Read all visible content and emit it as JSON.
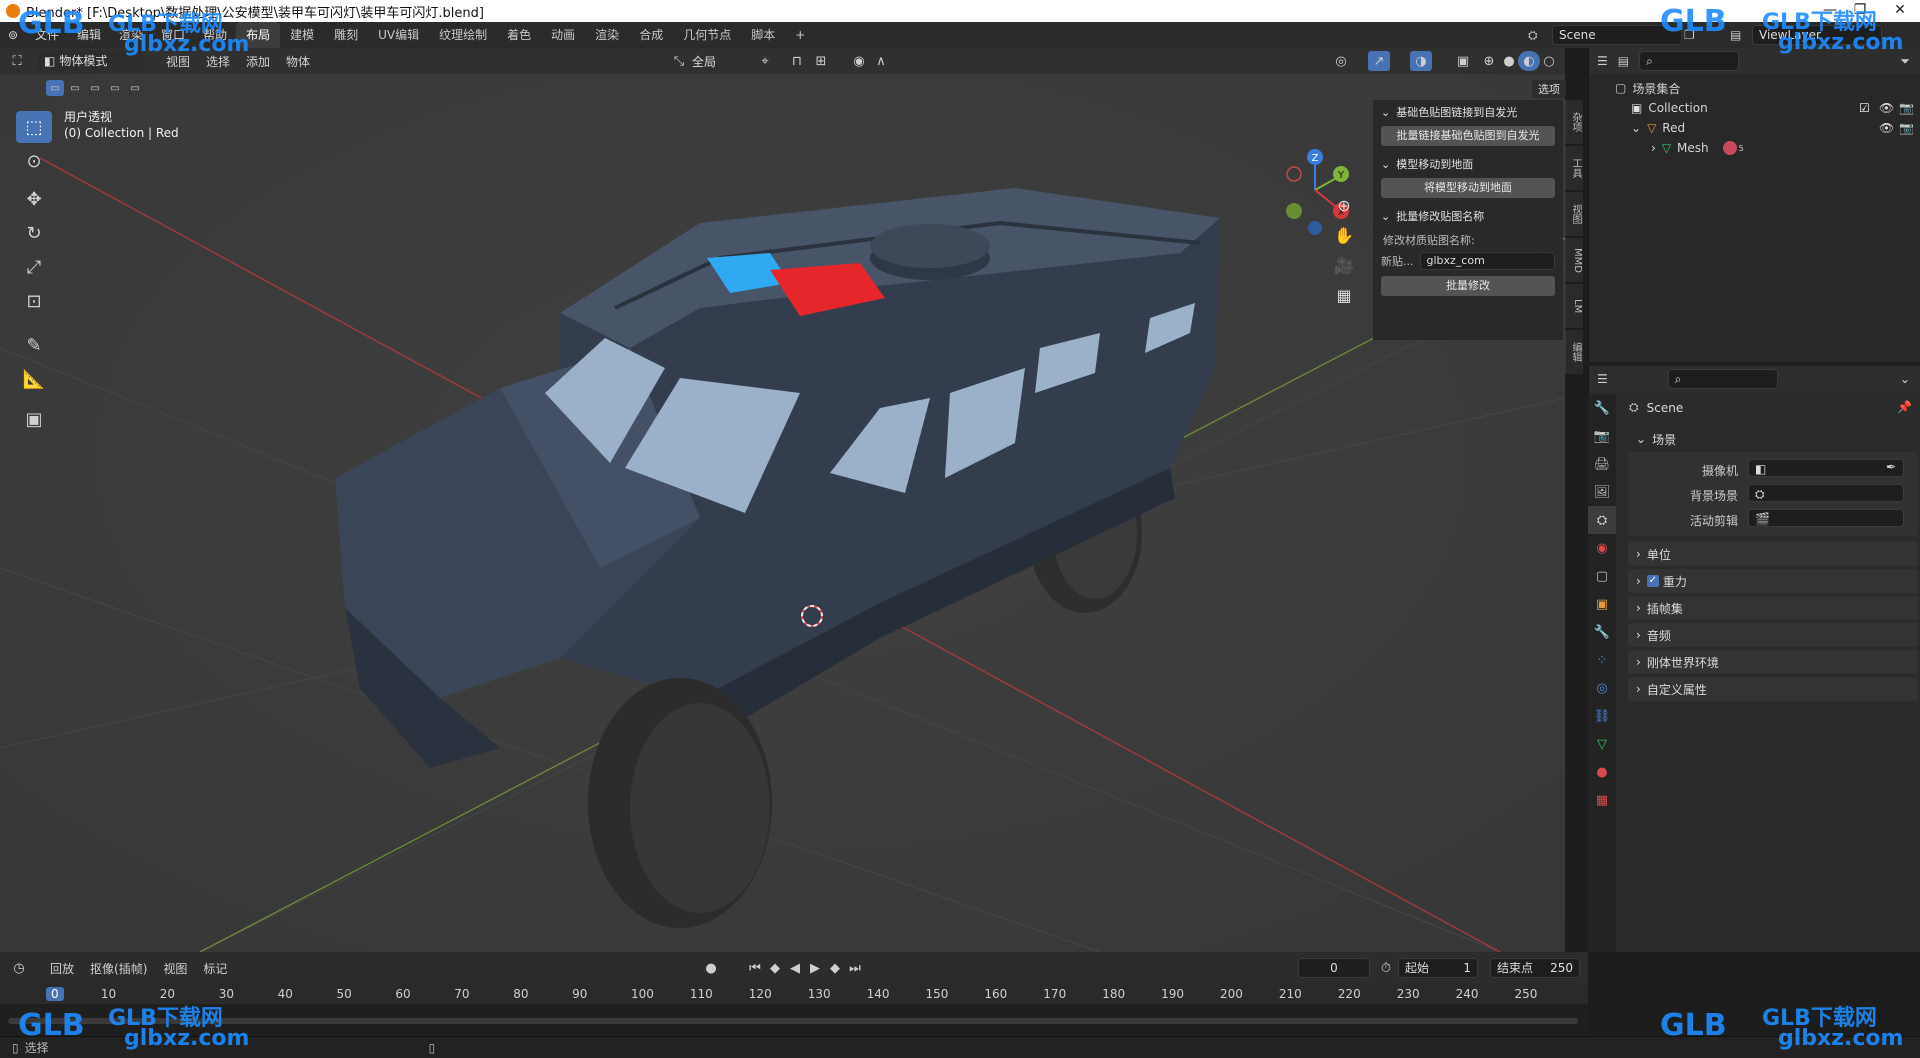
{
  "window": {
    "title": "Blender* [F:\\Desktop\\数据处理\\公安模型\\装甲车可闪灯\\装甲车可闪灯.blend]"
  },
  "topbar": {
    "menus": [
      "文件",
      "编辑",
      "渲染",
      "窗口",
      "帮助"
    ],
    "workspaces": [
      "布局",
      "建模",
      "雕刻",
      "UV编辑",
      "纹理绘制",
      "着色",
      "动画",
      "渲染",
      "合成",
      "几何节点",
      "脚本"
    ],
    "active_workspace": "布局",
    "add_tab": "+",
    "scene": "Scene",
    "view_layer": "ViewLayer"
  },
  "viewport": {
    "mode": "物体模式",
    "menus": [
      "视图",
      "选择",
      "添加",
      "物体"
    ],
    "transform_orientation": "全局",
    "options_label": "选项",
    "overlay_title": "用户透视",
    "overlay_subtitle": "(0) Collection | Red",
    "axis_labels": {
      "z": "Z",
      "y": "Y",
      "x": "X"
    }
  },
  "npanel": {
    "sections": [
      {
        "title": "基础色贴图链接到自发光",
        "button": "批量链接基础色贴图到自发光"
      },
      {
        "title": "模型移动到地面",
        "button": "将模型移动到地面"
      },
      {
        "title": "批量修改贴图名称",
        "label": "修改材质贴图名称:",
        "field_label": "新贴...",
        "field_value": "glbxz_com",
        "button": "批量修改"
      }
    ],
    "tabs": [
      "杂项",
      "工具",
      "视图",
      "MMD",
      "LM",
      "编辑"
    ]
  },
  "outliner": {
    "root": "场景集合",
    "items": [
      {
        "name": "Collection",
        "level": 1
      },
      {
        "name": "Red",
        "level": 1
      },
      {
        "name": "Mesh",
        "level": 2
      }
    ],
    "mesh_badge": "5"
  },
  "properties": {
    "header": "Scene",
    "panel": "场景",
    "camera_label": "摄像机",
    "bg_label": "背景场景",
    "clip_label": "活动剪辑",
    "sections": [
      "单位",
      "重力",
      "插帧集",
      "音频",
      "刚体世界环境",
      "自定义属性"
    ]
  },
  "timeline": {
    "menus": [
      "回放",
      "抠像(插帧)",
      "视图",
      "标记"
    ],
    "current_frame": "0",
    "start_label": "起始",
    "start_value": "1",
    "end_label": "结束点",
    "end_value": "250",
    "ruler": [
      "0",
      "10",
      "20",
      "30",
      "40",
      "50",
      "60",
      "70",
      "80",
      "90",
      "100",
      "110",
      "120",
      "130",
      "140",
      "150",
      "160",
      "170",
      "180",
      "190",
      "200",
      "210",
      "220",
      "230",
      "240",
      "250"
    ]
  },
  "statusbar": {
    "text": "选择"
  },
  "watermarks": {
    "brand": "GLB下载网",
    "url": "glbxz.com",
    "logo": "GLB"
  },
  "colors": {
    "accent": "#4772b3",
    "axis_x": "#d8373c",
    "axis_y": "#7fb33a",
    "axis_z": "#3b7ddc",
    "siren_blue": "#2aa6f0",
    "siren_red": "#e4262a",
    "vehicle": "#3b4659"
  }
}
